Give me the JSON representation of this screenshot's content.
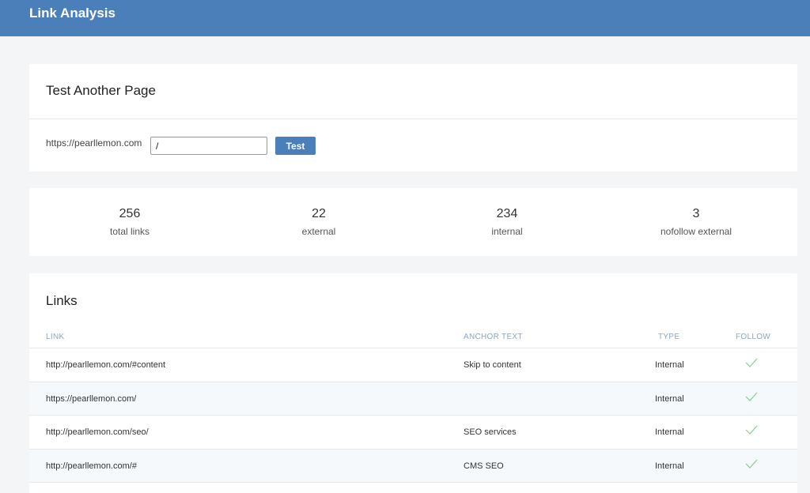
{
  "header": {
    "title": "Link Analysis"
  },
  "test_card": {
    "title": "Test Another Page",
    "domain": "https://pearllemon.com",
    "path_value": "/",
    "button_label": "Test"
  },
  "stats": [
    {
      "value": "256",
      "label": "total links"
    },
    {
      "value": "22",
      "label": "external"
    },
    {
      "value": "234",
      "label": "internal"
    },
    {
      "value": "3",
      "label": "nofollow external"
    }
  ],
  "links": {
    "title": "Links",
    "columns": {
      "link": "LINK",
      "anchor": "ANCHOR TEXT",
      "type": "TYPE",
      "follow": "FOLLOW"
    },
    "rows": [
      {
        "link": "http://pearllemon.com/#content",
        "anchor": "Skip to content",
        "type": "Internal",
        "follow": "check-icon"
      },
      {
        "link": "https://pearllemon.com/",
        "anchor": "",
        "type": "Internal",
        "follow": "check-icon"
      },
      {
        "link": "http://pearllemon.com/seo/",
        "anchor": "SEO services",
        "type": "Internal",
        "follow": "check-icon"
      },
      {
        "link": "http://pearllemon.com/#",
        "anchor": "CMS SEO",
        "type": "Internal",
        "follow": "check-icon"
      }
    ]
  },
  "colors": {
    "header_bg": "#4b7fba",
    "accent": "#4b7fba",
    "check": "#7fd08a",
    "page_bg": "#f4f5f7"
  }
}
